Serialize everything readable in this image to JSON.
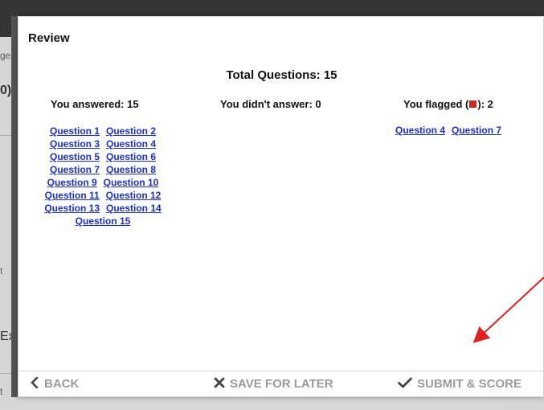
{
  "background": {
    "fragments": [
      "ge",
      "0)",
      "t",
      "Exa",
      "t"
    ]
  },
  "modal": {
    "title": "Review",
    "total_questions": "Total Questions: 15",
    "answered": {
      "label": "You answered: 15",
      "questions": [
        [
          "Question 1",
          "Question 2"
        ],
        [
          "Question 3",
          "Question 4"
        ],
        [
          "Question 5",
          "Question 6"
        ],
        [
          "Question 7",
          "Question 8"
        ],
        [
          "Question 9",
          "Question 10"
        ],
        [
          "Question 11",
          "Question 12"
        ],
        [
          "Question 13",
          "Question 14"
        ],
        [
          "Question 15"
        ]
      ]
    },
    "unanswered": {
      "label": "You didn't answer: 0"
    },
    "flagged": {
      "label_before": "You flagged (",
      "label_after": "): 2",
      "questions": [
        "Question 4",
        "Question 7"
      ]
    },
    "footer": {
      "back": "BACK",
      "save": "SAVE FOR LATER",
      "submit": "SUBMIT & SCORE"
    }
  },
  "colors": {
    "link": "#1a2fd6",
    "flag": "#d9261c",
    "annotation_arrow": "#e02020",
    "footer_text": "#9a9a9a"
  },
  "icons": {
    "back": "chevron-left-icon",
    "save": "x-icon",
    "submit": "checkmark-icon",
    "flag": "flag-icon"
  }
}
